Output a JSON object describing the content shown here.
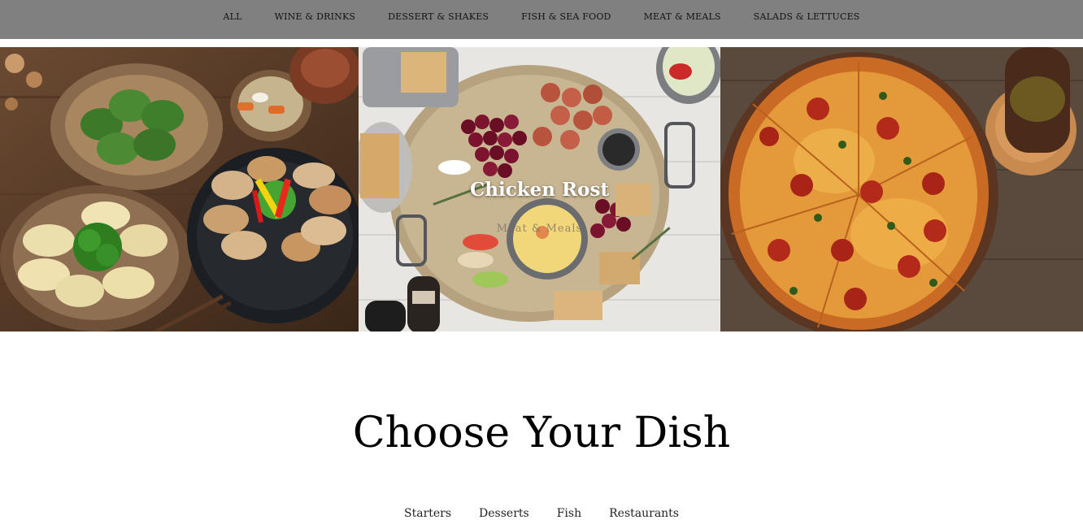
{
  "nav": {
    "items": [
      {
        "label": "ALL"
      },
      {
        "label": "WINE & DRINKS"
      },
      {
        "label": "DESSERT & SHAKES"
      },
      {
        "label": "FISH & SEA FOOD"
      },
      {
        "label": "MEAT & MEALS"
      },
      {
        "label": "SALADS & LETTUCES"
      }
    ]
  },
  "gallery": {
    "featured": {
      "title": "Chicken Rost",
      "subtitle": "Meat & Meals"
    }
  },
  "section": {
    "heading": "Choose Your Dish",
    "tabs": [
      {
        "label": "Starters"
      },
      {
        "label": "Desserts"
      },
      {
        "label": "Fish"
      },
      {
        "label": "Restaurants"
      }
    ]
  },
  "colors": {
    "nav_bg": "#808080",
    "page_bg": "#ffffff",
    "heading_text": "#000000"
  }
}
